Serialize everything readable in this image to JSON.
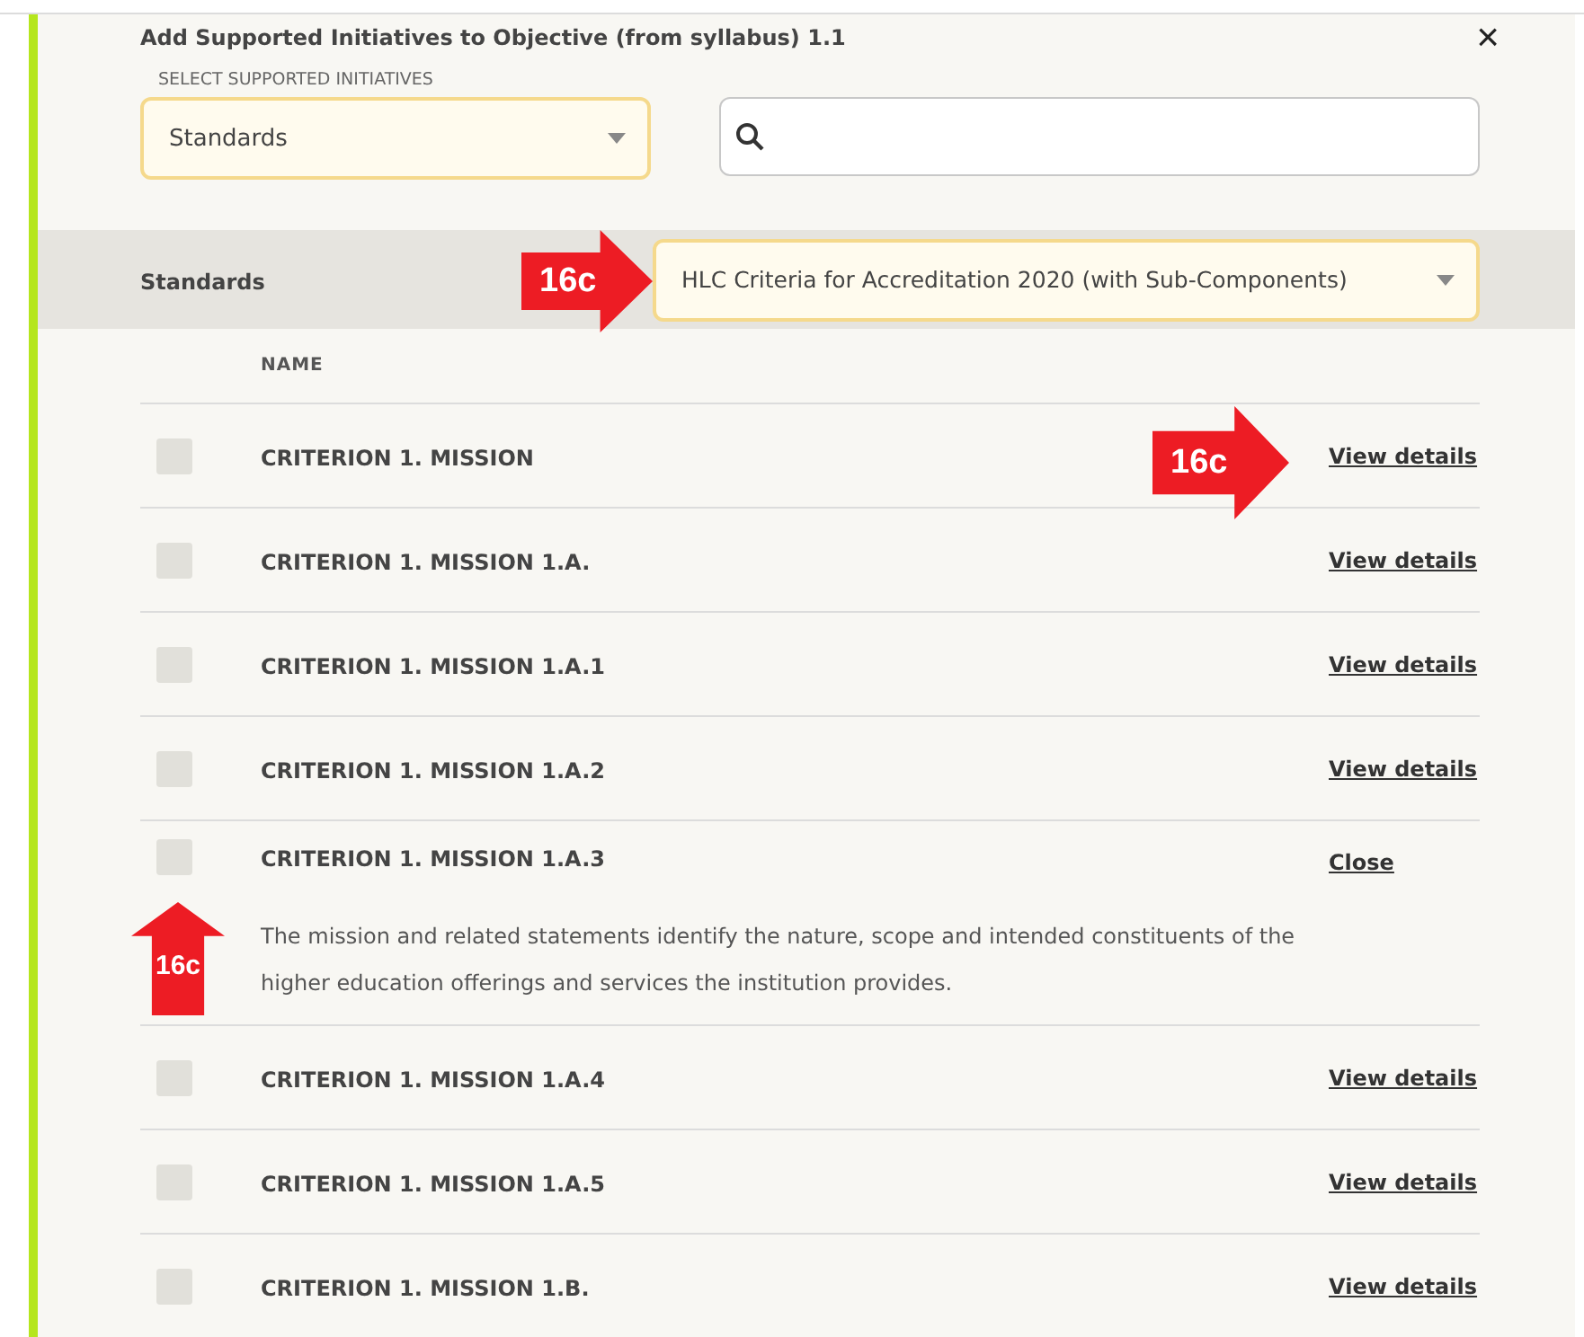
{
  "dialog": {
    "title": "Add Supported Initiatives to Objective (from syllabus) 1.1",
    "close": "×"
  },
  "initiative_select": {
    "label": "SELECT SUPPORTED INITIATIVES",
    "value": "Standards"
  },
  "standards_bar": {
    "label": "Standards",
    "value": "HLC Criteria for Accreditation 2020 (with Sub-Components)"
  },
  "table": {
    "columns": [
      "NAME"
    ],
    "rows": [
      {
        "name": "CRITERION 1. MISSION",
        "checked": false,
        "expanded": false,
        "link": "View details"
      },
      {
        "name": "CRITERION 1. MISSION 1.A.",
        "checked": false,
        "expanded": false,
        "link": "View details"
      },
      {
        "name": "CRITERION 1. MISSION 1.A.1",
        "checked": false,
        "expanded": false,
        "link": "View details"
      },
      {
        "name": "CRITERION 1. MISSION 1.A.2",
        "checked": false,
        "expanded": false,
        "link": "View details"
      },
      {
        "name": "CRITERION 1. MISSION 1.A.3",
        "checked": false,
        "expanded": true,
        "link": "Close",
        "description": "The mission and related statements identify the nature, scope and intended constituents of the higher education offerings and services the institution provides."
      },
      {
        "name": "CRITERION 1. MISSION 1.A.4",
        "checked": false,
        "expanded": false,
        "link": "View details"
      },
      {
        "name": "CRITERION 1. MISSION 1.A.5",
        "checked": false,
        "expanded": false,
        "link": "View details"
      },
      {
        "name": "CRITERION 1. MISSION 1.B.",
        "checked": false,
        "expanded": false,
        "link": "View details"
      }
    ]
  },
  "callouts": [
    {
      "label": "16c",
      "kind": "right"
    },
    {
      "label": "16c",
      "kind": "right"
    },
    {
      "label": "16c",
      "kind": "up"
    }
  ]
}
